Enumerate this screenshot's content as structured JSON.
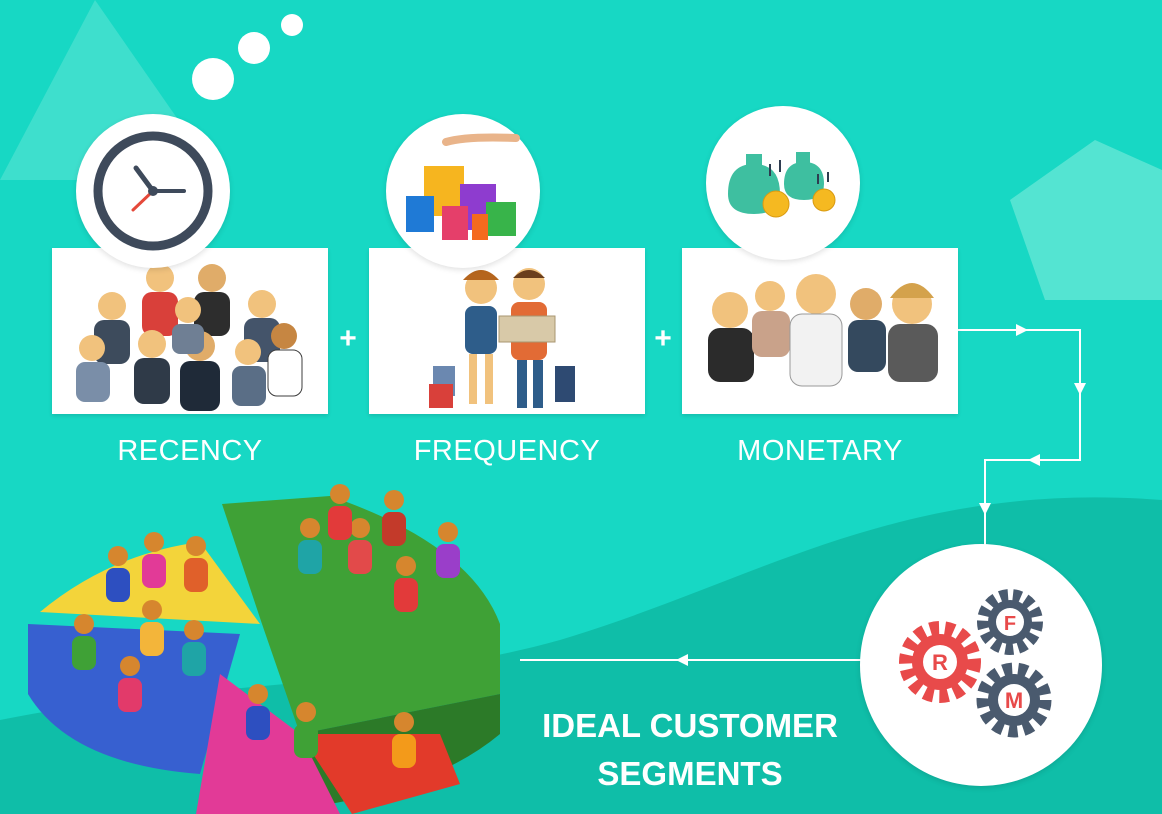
{
  "steps": [
    {
      "label": "RECENCY",
      "icon": "clock-icon"
    },
    {
      "label": "FREQUENCY",
      "icon": "shopping-bags-icon"
    },
    {
      "label": "MONETARY",
      "icon": "money-bags-icon"
    }
  ],
  "operators": [
    "+",
    "+"
  ],
  "rfm": {
    "r": "R",
    "f": "F",
    "m": "M"
  },
  "outcome": {
    "line1": "IDEAL CUSTOMER",
    "line2": "SEGMENTS"
  },
  "colors": {
    "background": "#17d8c4",
    "red_gear": "#e84a4a",
    "slate_gear": "#4a5a6e",
    "arrow": "#ffffff"
  }
}
